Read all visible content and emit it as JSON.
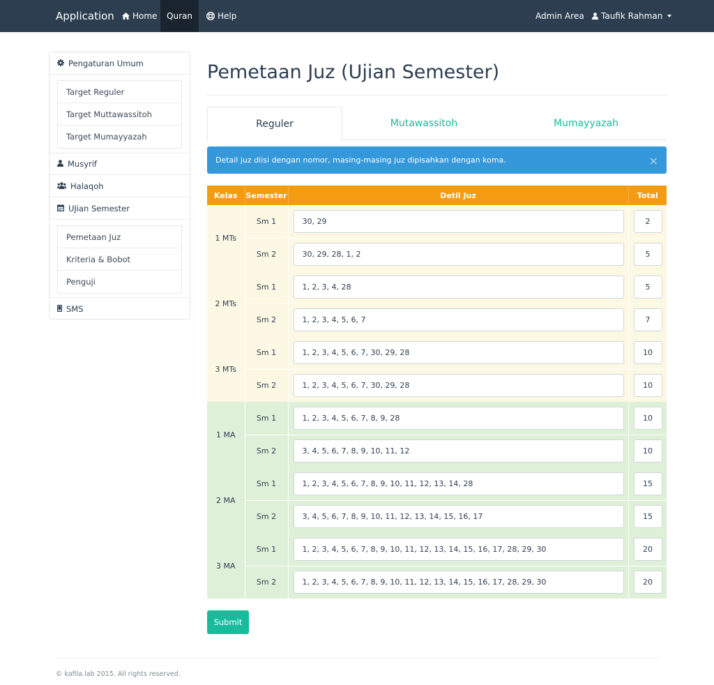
{
  "navbar": {
    "brand": "Application",
    "items": [
      {
        "label": "Home",
        "icon": "home-icon"
      },
      {
        "label": "Quran",
        "active": true
      },
      {
        "label": "Help",
        "icon": "lifebuoy-icon"
      }
    ],
    "admin_area": "Admin Area",
    "user": "Taufik Rahman",
    "user_icon": "user-icon"
  },
  "sidebar": {
    "pengaturan": {
      "label": "Pengaturan Umum",
      "icon": "gear-icon"
    },
    "pengaturan_sub": [
      "Target Reguler",
      "Target Muttawassitoh",
      "Target Mumayyazah"
    ],
    "musyrif": {
      "label": "Musyrif",
      "icon": "user-icon"
    },
    "halaqoh": {
      "label": "Halaqoh",
      "icon": "users-icon"
    },
    "ujian": {
      "label": "UJian Semester",
      "icon": "calendar-icon"
    },
    "ujian_sub": [
      "Pemetaan Juz",
      "Kriteria & Bobot",
      "Penguji"
    ],
    "sms": {
      "label": "SMS",
      "icon": "mobile-icon"
    }
  },
  "main": {
    "title": "Pemetaan Juz (Ujian Semester)",
    "tabs": [
      {
        "label": "Reguler",
        "active": true
      },
      {
        "label": "Mutawassitoh"
      },
      {
        "label": "Mumayyazah"
      }
    ],
    "alert": "Detail juz diisi dengan nomor, masing-masing juz dipisahkan dengan koma.",
    "alert_close": "×",
    "table": {
      "headers": [
        "Kelas",
        "Semester",
        "Detil Juz",
        "Total"
      ],
      "groups": [
        {
          "kelas": "1 MTs",
          "tone": "mts",
          "rows": [
            {
              "sem": "Sm 1",
              "juz": "30, 29",
              "total": "2"
            },
            {
              "sem": "Sm 2",
              "juz": "30, 29, 28, 1, 2",
              "total": "5"
            }
          ]
        },
        {
          "kelas": "2 MTs",
          "tone": "mts",
          "rows": [
            {
              "sem": "Sm 1",
              "juz": "1, 2, 3, 4, 28",
              "total": "5"
            },
            {
              "sem": "Sm 2",
              "juz": "1, 2, 3, 4, 5, 6, 7",
              "total": "7"
            }
          ]
        },
        {
          "kelas": "3 MTs",
          "tone": "mts",
          "rows": [
            {
              "sem": "Sm 1",
              "juz": "1, 2, 3, 4, 5, 6, 7, 30, 29, 28",
              "total": "10"
            },
            {
              "sem": "Sm 2",
              "juz": "1, 2, 3, 4, 5, 6, 7, 30, 29, 28",
              "total": "10"
            }
          ]
        },
        {
          "kelas": "1 MA",
          "tone": "ma",
          "rows": [
            {
              "sem": "Sm 1",
              "juz": "1, 2, 3, 4, 5, 6, 7, 8, 9, 28",
              "total": "10"
            },
            {
              "sem": "Sm 2",
              "juz": "3, 4, 5, 6, 7, 8, 9, 10, 11, 12",
              "total": "10"
            }
          ]
        },
        {
          "kelas": "2 MA",
          "tone": "ma",
          "rows": [
            {
              "sem": "Sm 1",
              "juz": "1, 2, 3, 4, 5, 6, 7, 8, 9, 10, 11, 12, 13, 14, 28",
              "total": "15"
            },
            {
              "sem": "Sm 2",
              "juz": "3, 4, 5, 6, 7, 8, 9, 10, 11, 12, 13, 14, 15, 16, 17",
              "total": "15"
            }
          ]
        },
        {
          "kelas": "3 MA",
          "tone": "ma",
          "rows": [
            {
              "sem": "Sm 1",
              "juz": "1, 2, 3, 4, 5, 6, 7, 8, 9, 10, 11, 12, 13, 14, 15, 16, 17, 28, 29, 30",
              "total": "20"
            },
            {
              "sem": "Sm 2",
              "juz": "1, 2, 3, 4, 5, 6, 7, 8, 9, 10, 11, 12, 13, 14, 15, 16, 17, 28, 29, 30",
              "total": "20"
            }
          ]
        }
      ]
    },
    "submit": "Submit"
  },
  "footer": "© kafila.lab 2015. All rights reserved.",
  "colors": {
    "navbar": "#2c3e50",
    "accent": "#18bc9c",
    "info": "#3498db",
    "table_header": "#f39c12",
    "mts_row": "#fcf8e3",
    "ma_row": "#dff0d8"
  }
}
